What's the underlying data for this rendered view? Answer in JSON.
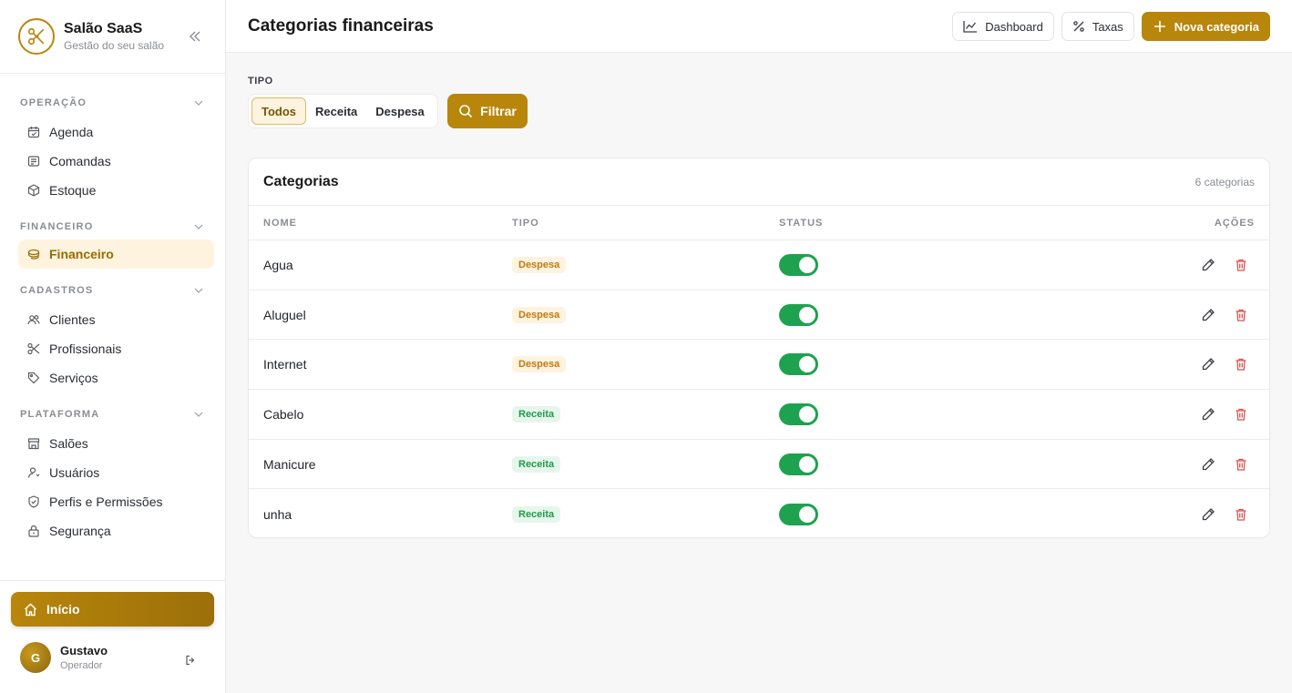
{
  "brand": {
    "title": "Salão SaaS",
    "subtitle": "Gestão do seu salão"
  },
  "sidebar": {
    "sections": [
      {
        "label": "OPERAÇÃO",
        "items": [
          {
            "label": "Agenda",
            "icon": "calendar-icon"
          },
          {
            "label": "Comandas",
            "icon": "receipt-icon"
          },
          {
            "label": "Estoque",
            "icon": "box-icon"
          }
        ]
      },
      {
        "label": "FINANCEIRO",
        "items": [
          {
            "label": "Financeiro",
            "icon": "money-icon",
            "active": true
          }
        ]
      },
      {
        "label": "CADASTROS",
        "items": [
          {
            "label": "Clientes",
            "icon": "users-icon"
          },
          {
            "label": "Profissionais",
            "icon": "scissors-icon"
          },
          {
            "label": "Serviços",
            "icon": "tag-icon"
          }
        ]
      },
      {
        "label": "PLATAFORMA",
        "items": [
          {
            "label": "Salões",
            "icon": "store-icon"
          },
          {
            "label": "Usuários",
            "icon": "user-icon"
          },
          {
            "label": "Perfis e Permissões",
            "icon": "shield-icon"
          },
          {
            "label": "Segurança",
            "icon": "lock-icon"
          }
        ]
      }
    ],
    "home_label": "Início"
  },
  "user": {
    "initial": "G",
    "name": "Gustavo",
    "role": "Operador"
  },
  "header": {
    "title": "Categorias financeiras",
    "dashboard_label": "Dashboard",
    "taxas_label": "Taxas",
    "new_label": "Nova categoria"
  },
  "filter": {
    "label": "TIPO",
    "options": [
      "Todos",
      "Receita",
      "Despesa"
    ],
    "selected": "Todos",
    "button_label": "Filtrar"
  },
  "table": {
    "title": "Categorias",
    "count": "6 categorias",
    "columns": {
      "nome": "NOME",
      "tipo": "TIPO",
      "status": "STATUS",
      "acoes": "AÇÕES"
    },
    "rows": [
      {
        "nome": "Agua",
        "tipo": "Despesa",
        "ativo": true
      },
      {
        "nome": "Aluguel",
        "tipo": "Despesa",
        "ativo": true
      },
      {
        "nome": "Internet",
        "tipo": "Despesa",
        "ativo": true
      },
      {
        "nome": "Cabelo",
        "tipo": "Receita",
        "ativo": true
      },
      {
        "nome": "Manicure",
        "tipo": "Receita",
        "ativo": true
      },
      {
        "nome": "unha",
        "tipo": "Receita",
        "ativo": true
      }
    ]
  },
  "colors": {
    "accent": "#b8860b",
    "toggle_on": "#1fa24f",
    "danger": "#d9534f"
  }
}
